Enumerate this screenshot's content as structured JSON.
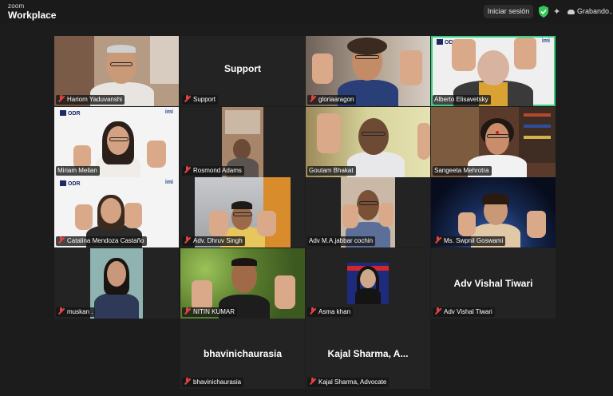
{
  "app": {
    "brand_small": "zoom",
    "brand_big": "Workplace",
    "signin_label": "Iniciar sesión",
    "recording_label": "Grabando..."
  },
  "participants": [
    {
      "name": "Hariom Yaduvanshi",
      "muted": true
    },
    {
      "name": "Support",
      "muted": true,
      "video_off": true,
      "display_name": "Support"
    },
    {
      "name": "gloriaaragon",
      "muted": true
    },
    {
      "name": "Alberto Elisavetsky",
      "muted": false,
      "active_speaker": true
    },
    {
      "name": "Miriam Melian",
      "muted": false
    },
    {
      "name": "Rosmond Adams",
      "muted": true
    },
    {
      "name": "Goutam Bhakat",
      "muted": false
    },
    {
      "name": "Sangeeta Mehrotra",
      "muted": false
    },
    {
      "name": "Catalina Mendoza Castaño",
      "muted": true
    },
    {
      "name": "Adv. Dhruv Singh",
      "muted": true
    },
    {
      "name": "Adv M.A.jabbar cochin",
      "muted": false
    },
    {
      "name": "Ms. Swpnil Goswami",
      "muted": true
    },
    {
      "name": "muskan .",
      "muted": true
    },
    {
      "name": "NITIN KUMAR",
      "muted": true
    },
    {
      "name": "Asma khan",
      "muted": true
    },
    {
      "name": "Adv Vishal Tiwari",
      "muted": true,
      "video_off": true,
      "display_name": "Adv Vishal Tiwari"
    },
    {
      "name": "bhavinichaurasia",
      "muted": true,
      "video_off": true,
      "display_name": "bhavinichaurasia"
    },
    {
      "name": "Kajal Sharma, Advocate",
      "muted": true,
      "video_off": true,
      "display_name": "Kajal Sharma, A..."
    }
  ],
  "logos": {
    "odr": "ODR",
    "imi": "imi"
  },
  "colors": {
    "active_border": "#35d07f",
    "muted_mic": "#e34343",
    "shield": "#35c759"
  }
}
